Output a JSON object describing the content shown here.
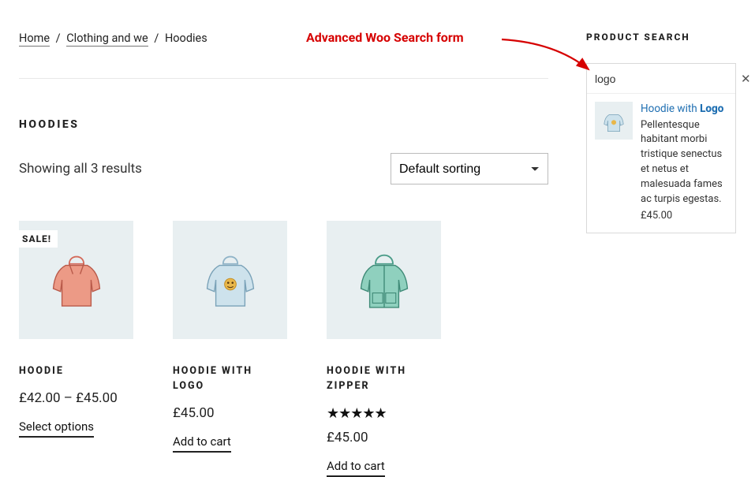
{
  "annotation": {
    "label": "Advanced Woo Search form"
  },
  "breadcrumb": {
    "home": "Home",
    "cat": "Clothing and we",
    "current": "Hoodies"
  },
  "category_title": "HOODIES",
  "toolbar": {
    "results_text": "Showing all 3 results",
    "sort_selected": "Default sorting"
  },
  "sale_label": "SALE!",
  "products": [
    {
      "title": "HOODIE",
      "price": "£42.00 – £45.00",
      "button": "Select options"
    },
    {
      "title": "HOODIE WITH LOGO",
      "price": "£45.00",
      "button": "Add to cart"
    },
    {
      "title": "HOODIE WITH ZIPPER",
      "price": "£45.00",
      "button": "Add to cart",
      "rating": "★★★★★"
    }
  ],
  "sidebar": {
    "title": "PRODUCT SEARCH",
    "search_value": "logo",
    "result": {
      "title_prefix": "Hoodie with ",
      "title_bold": "Logo",
      "desc": "Pellentesque habitant morbi tristique senectus et netus et malesuada fames ac turpis egestas.",
      "price": "£45.00"
    }
  }
}
